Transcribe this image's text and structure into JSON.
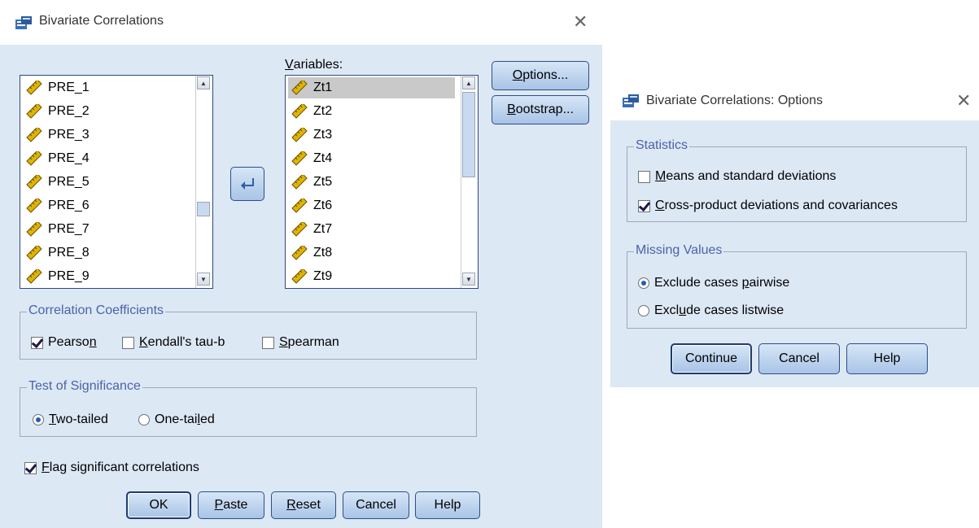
{
  "main_dialog": {
    "title": "Bivariate Correlations",
    "source_list": [
      "PRE_1",
      "PRE_2",
      "PRE_3",
      "PRE_4",
      "PRE_5",
      "PRE_6",
      "PRE_7",
      "PRE_8",
      "PRE_9"
    ],
    "variables_label_u": "V",
    "variables_label_rest": "ariables:",
    "variables_list": [
      "Zt1",
      "Zt2",
      "Zt3",
      "Zt4",
      "Zt5",
      "Zt6",
      "Zt7",
      "Zt8",
      "Zt9"
    ],
    "selected_variable": "Zt1",
    "options_button": {
      "u": "O",
      "rest": "ptions..."
    },
    "bootstrap_button": {
      "u": "B",
      "rest": "ootstrap..."
    },
    "coefficients": {
      "legend": "Correlation Coefficients",
      "pearson": {
        "pre": "Pearso",
        "u": "n",
        "post": "",
        "checked": true
      },
      "kendall": {
        "pre": "",
        "u": "K",
        "post": "endall's tau-b",
        "checked": false
      },
      "spearman": {
        "pre": "",
        "u": "S",
        "post": "pearman",
        "checked": false
      }
    },
    "significance": {
      "legend": "Test of Significance",
      "two_tailed": {
        "pre": "",
        "u": "T",
        "post": "wo-tailed",
        "selected": true
      },
      "one_tailed": {
        "pre": "One-tai",
        "u": "l",
        "post": "ed",
        "selected": false
      }
    },
    "flag": {
      "pre": "",
      "u": "F",
      "post": "lag significant correlations",
      "checked": true
    },
    "buttons": {
      "ok": "OK",
      "paste": {
        "u": "P",
        "rest": "aste"
      },
      "reset": {
        "u": "R",
        "rest": "eset"
      },
      "cancel": "Cancel",
      "help": "Help"
    }
  },
  "options_dialog": {
    "title": "Bivariate Correlations: Options",
    "statistics": {
      "legend": "Statistics",
      "means": {
        "pre": "",
        "u": "M",
        "post": "eans and standard deviations",
        "checked": false
      },
      "cross": {
        "pre": "",
        "u": "C",
        "post": "ross-product deviations and covariances",
        "checked": true
      }
    },
    "missing": {
      "legend": "Missing Values",
      "pairwise": {
        "pre": "Exclude cases ",
        "u": "p",
        "post": "airwise",
        "selected": true
      },
      "listwise": {
        "pre": "Excl",
        "u": "u",
        "post": "de cases listwise",
        "selected": false
      }
    },
    "buttons": {
      "continue": "Continue",
      "cancel": "Cancel",
      "help": "Help"
    }
  },
  "colors": {
    "dialog_bg": "#dde8f5",
    "legend_text": "#4a63a8",
    "button_top": "#d7e6f7",
    "button_bottom": "#a8c4e6"
  },
  "icons": {
    "app": "spss-app-icon",
    "close": "close-icon",
    "variable": "scale-ruler-icon",
    "move": "arrow-left-icon"
  }
}
